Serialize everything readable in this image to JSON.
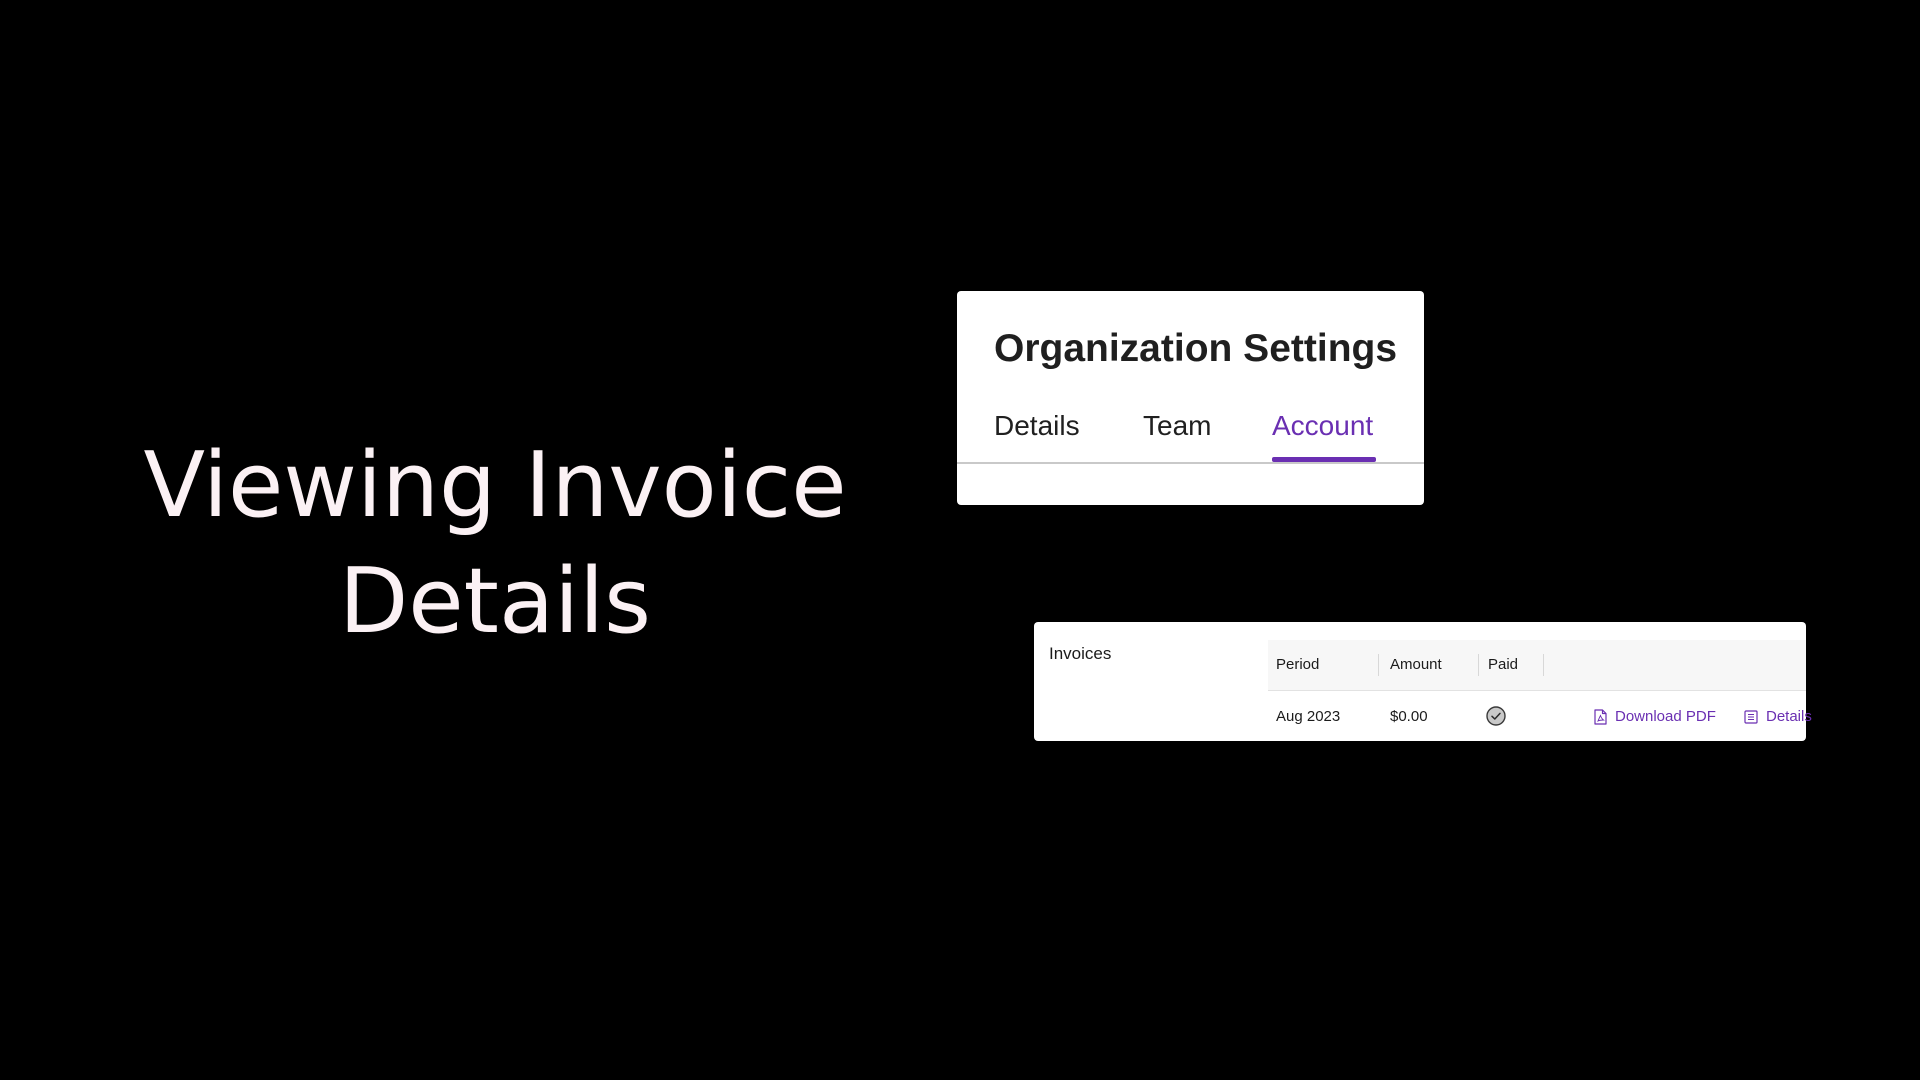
{
  "headline": {
    "line1": "Viewing Invoice",
    "line2": "Details"
  },
  "org_settings": {
    "title": "Organization Settings",
    "tabs": [
      {
        "label": "Details",
        "active": false
      },
      {
        "label": "Team",
        "active": false
      },
      {
        "label": "Account",
        "active": true
      }
    ],
    "accent_color": "#6a2fb2"
  },
  "invoices": {
    "heading": "Invoices",
    "columns": [
      "Period",
      "Amount",
      "Paid"
    ],
    "rows": [
      {
        "period": "Aug 2023",
        "amount": "$0.00",
        "paid_icon": "check-circle-icon",
        "actions": [
          {
            "label": "Download PDF",
            "icon": "pdf-file-icon"
          },
          {
            "label": "Details",
            "icon": "document-list-icon"
          }
        ]
      }
    ]
  }
}
